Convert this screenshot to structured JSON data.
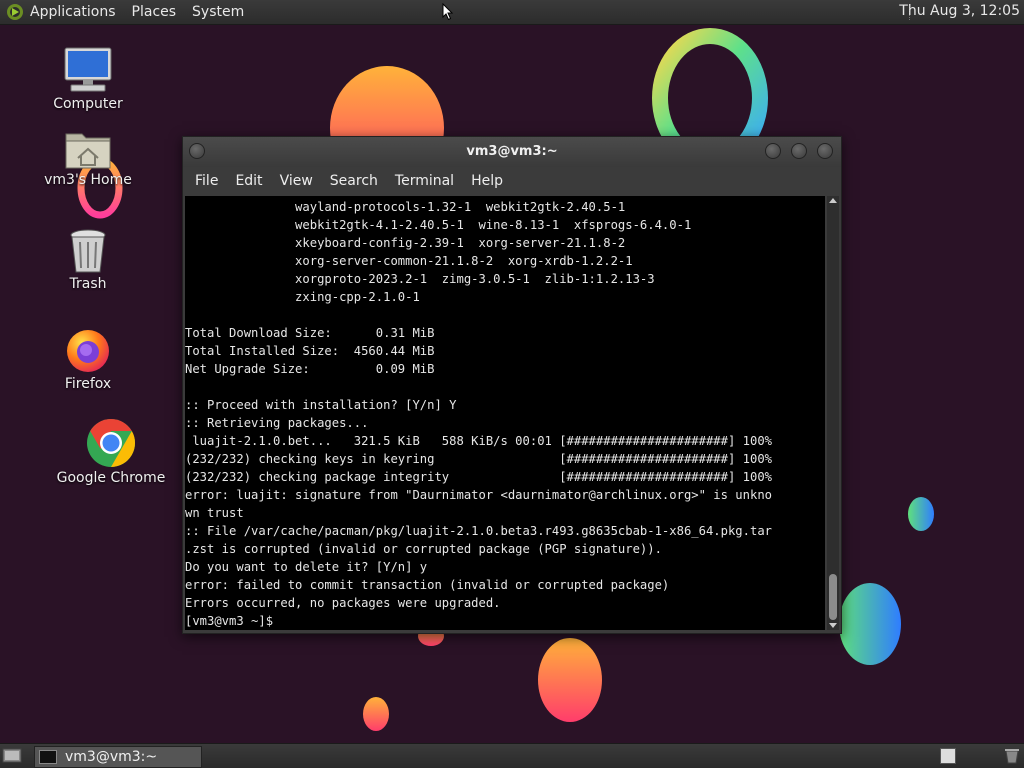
{
  "top_panel": {
    "menus": [
      "Applications",
      "Places",
      "System"
    ],
    "clock": "Thu Aug  3, 12:05"
  },
  "desktop": {
    "icons": [
      {
        "label": "Computer",
        "icon": "computer-icon"
      },
      {
        "label": "vm3's Home",
        "icon": "home-folder-icon"
      },
      {
        "label": "Trash",
        "icon": "trash-icon"
      },
      {
        "label": "Firefox",
        "icon": "firefox-icon"
      },
      {
        "label": "Google Chrome",
        "icon": "chrome-icon"
      }
    ]
  },
  "terminal": {
    "title": "vm3@vm3:~",
    "menus": [
      "File",
      "Edit",
      "View",
      "Search",
      "Terminal",
      "Help"
    ],
    "output": "               wayland-protocols-1.32-1  webkit2gtk-2.40.5-1\n               webkit2gtk-4.1-2.40.5-1  wine-8.13-1  xfsprogs-6.4.0-1\n               xkeyboard-config-2.39-1  xorg-server-21.1.8-2\n               xorg-server-common-21.1.8-2  xorg-xrdb-1.2.2-1\n               xorgproto-2023.2-1  zimg-3.0.5-1  zlib-1:1.2.13-3\n               zxing-cpp-2.1.0-1\n\nTotal Download Size:      0.31 MiB\nTotal Installed Size:  4560.44 MiB\nNet Upgrade Size:         0.09 MiB\n\n:: Proceed with installation? [Y/n] Y\n:: Retrieving packages...\n luajit-2.1.0.bet...   321.5 KiB   588 KiB/s 00:01 [######################] 100%\n(232/232) checking keys in keyring                 [######################] 100%\n(232/232) checking package integrity               [######################] 100%\nerror: luajit: signature from \"Daurnimator <daurnimator@archlinux.org>\" is unkno\nwn trust\n:: File /var/cache/pacman/pkg/luajit-2.1.0.beta3.r493.g8635cbab-1-x86_64.pkg.tar\n.zst is corrupted (invalid or corrupted package (PGP signature)).\nDo you want to delete it? [Y/n] y\nerror: failed to commit transaction (invalid or corrupted package)\nErrors occurred, no packages were upgraded.\n[vm3@vm3 ~]$ "
  },
  "bottom_panel": {
    "task_label": "vm3@vm3:~"
  },
  "colors": {
    "desktop_background": "#2a1226",
    "terminal_background": "#000000",
    "terminal_text": "#e6e6e6",
    "panel_background": "#333333"
  }
}
